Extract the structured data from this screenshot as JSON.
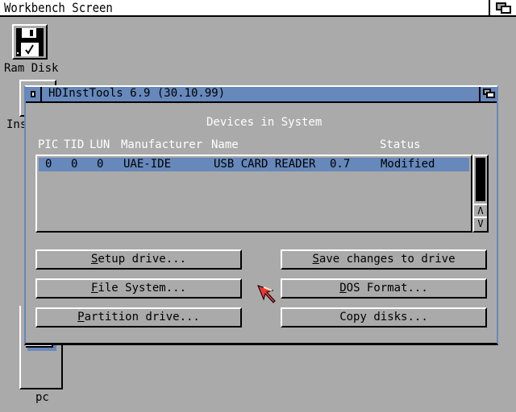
{
  "screen": {
    "title": "Workbench Screen"
  },
  "desktop": {
    "icons": [
      {
        "label": "Ram Disk",
        "icon": "ram-disk-icon"
      },
      {
        "label": "Ins",
        "icon": "drawer-icon"
      },
      {
        "label": "pc",
        "icon": "drawer-icon"
      }
    ]
  },
  "window": {
    "title": "HDInstTools 6.9 (30.10.99)",
    "heading": "Devices in System",
    "columns": [
      "PIC",
      "TID",
      "LUN",
      "Manufacturer",
      "Name",
      "Status"
    ],
    "rows": [
      {
        "pic": "0",
        "tid": "0",
        "lun": "0",
        "manufacturer": "UAE-IDE",
        "name": "USB CARD READER",
        "revision": "0.7",
        "status": "Modified"
      }
    ],
    "buttons": {
      "setup": {
        "key": "S",
        "rest": "etup drive..."
      },
      "save": {
        "key": "S",
        "rest": "ave changes to drive"
      },
      "filesystem": {
        "key": "F",
        "rest": "ile System..."
      },
      "dosformat": {
        "key": "D",
        "rest": "OS Format..."
      },
      "partition": {
        "key": "P",
        "rest": "artition drive..."
      },
      "copy": {
        "label": "Copy disks..."
      }
    }
  },
  "colors": {
    "background": "#aaaaaa",
    "accent": "#6688bb",
    "cursor": "#ee3333"
  }
}
